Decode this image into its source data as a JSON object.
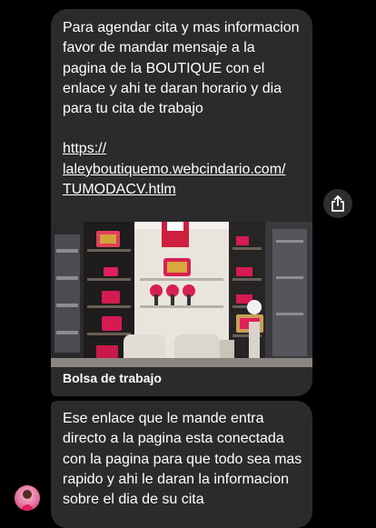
{
  "messages": [
    {
      "text": "Para agendar cita y mas informacion favor de mandar mensaje a la pagina de la BOUTIQUE con el enlace y ahi te daran horario y dia para tu cita de trabajo",
      "link": "https://\nlaleyboutiquemo.webcindario.com/\nTUMODACV.htlm",
      "link_preview_title": "Bolsa de trabajo"
    },
    {
      "text": "Ese enlace que le mande entra directo a la pagina esta conectada con la pagina para que todo sea mas rapido y ahi le daran la informacion sobre el dia de su cita"
    }
  ],
  "icons": {
    "share": "share-icon",
    "avatar": "contact-avatar"
  },
  "colors": {
    "background": "#000000",
    "bubble": "#2b2b2d",
    "text": "#ffffff",
    "accent_pink": "#e0205a"
  }
}
